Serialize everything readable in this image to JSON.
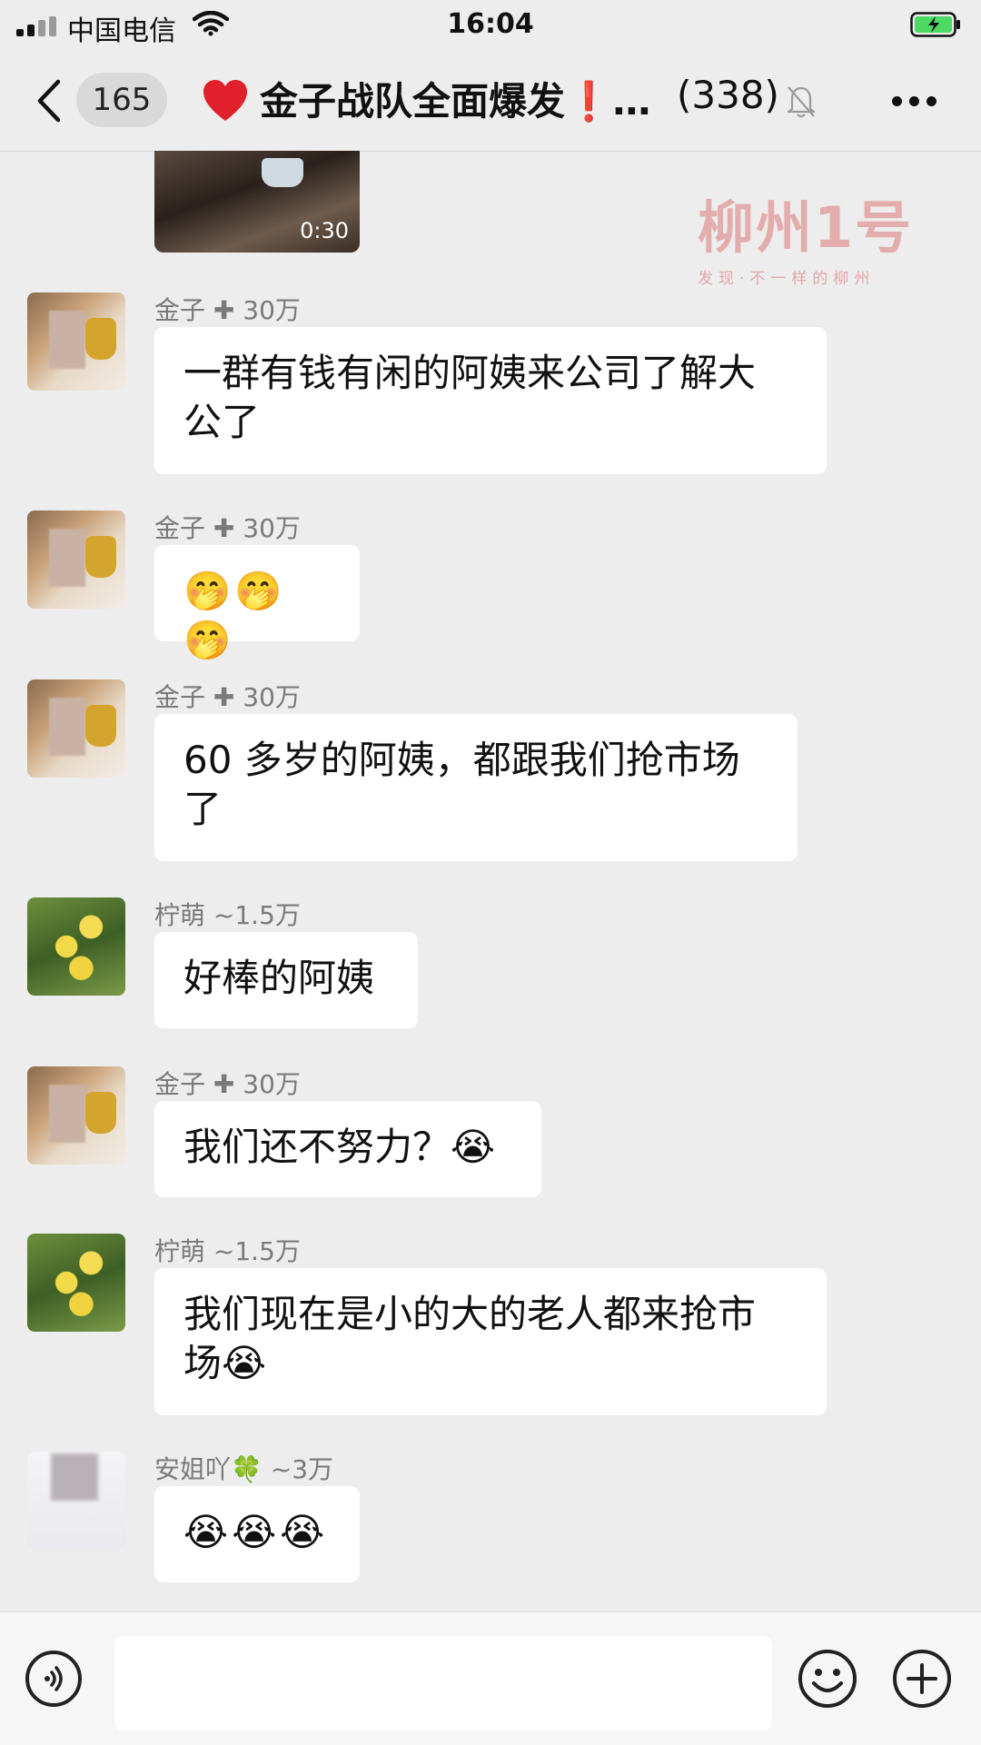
{
  "status_bar": {
    "carrier": "中国电信",
    "time": "16:04"
  },
  "header": {
    "unread_count": "165",
    "title_main": "金子战队全面爆发",
    "title_excl": "❗",
    "title_ellipsis": "…",
    "member_count": "(338)"
  },
  "video": {
    "duration": "0:30"
  },
  "watermark": {
    "logo": "柳州1号",
    "slogan": "发现·不一样的柳州"
  },
  "messages": [
    {
      "sender": "金子 ✚ 30万",
      "avatar": "jinzi",
      "lines": [
        "一群有钱有闲的阿姨来公司了解大",
        "公了"
      ]
    },
    {
      "sender": "金子 ✚ 30万",
      "avatar": "jinzi",
      "lines": [
        "🤭🤭🤭"
      ]
    },
    {
      "sender": "金子 ✚ 30万",
      "avatar": "jinzi",
      "lines": [
        "60 多岁的阿姨，都跟我们抢市场",
        "了"
      ]
    },
    {
      "sender": "柠萌 ~1.5万",
      "avatar": "ningmeng",
      "lines": [
        "好棒的阿姨"
      ]
    },
    {
      "sender": "金子 ✚ 30万",
      "avatar": "jinzi",
      "lines": [
        "我们还不努力？😭"
      ]
    },
    {
      "sender": "柠萌 ~1.5万",
      "avatar": "ningmeng",
      "lines": [
        "我们现在是小的大的老人都来抢市",
        "场😭"
      ]
    },
    {
      "sender": "安姐吖🍀 ~3万",
      "avatar": "anjie",
      "lines": [
        "😭😭😭"
      ]
    }
  ],
  "input": {
    "value": "",
    "placeholder": ""
  },
  "colors": {
    "background": "#ededed",
    "bubble": "#ffffff",
    "sender_text": "#7a7a7a",
    "battery_green": "#4cd964",
    "heart_red": "#e0202a"
  },
  "icons": [
    "signal-icon",
    "wifi-icon",
    "battery-charging-icon",
    "back-arrow-icon",
    "heart-icon",
    "mute-bell-icon",
    "more-icon",
    "voice-icon",
    "emoji-icon",
    "plus-icon"
  ]
}
